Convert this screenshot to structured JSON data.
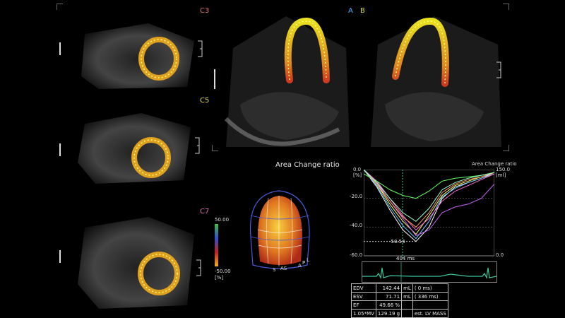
{
  "views": {
    "c3": {
      "label": "C3",
      "color": "#e07070"
    },
    "c5": {
      "label": "C5",
      "color": "#e5d65a"
    },
    "c7": {
      "label": "C7",
      "color": "#e070b0"
    },
    "a": {
      "label": "A",
      "color": "#55aaff"
    },
    "b": {
      "label": "B",
      "color": "#d6d64a"
    }
  },
  "heading": "Area Change ratio",
  "colorbar": {
    "max": "50.00",
    "min": "-50.00",
    "unit": "[%]"
  },
  "bullseye": {
    "labels": [
      "S",
      "AS",
      "A",
      "P",
      "L"
    ]
  },
  "graph": {
    "title": "Area Change ratio",
    "y_left_top": "0.0",
    "y_left_unit": "[%]",
    "y_right_top": "150.0",
    "y_right_unit": "[ml]",
    "y_right_bottom": "0.0",
    "ticks": [
      "-20.0",
      "-40.0",
      "-60.0"
    ],
    "peak_label": "-50.54",
    "time_label": "404 ms"
  },
  "chart_data": {
    "type": "line",
    "title": "Area Change ratio",
    "xlabel": "",
    "ylabel": "[%]",
    "ylim": [
      -60,
      0
    ],
    "x": [
      0,
      0.1,
      0.2,
      0.3,
      0.4,
      0.5,
      0.6,
      0.7,
      0.8,
      0.9,
      1.0
    ],
    "series": [
      {
        "color": "#ffffff",
        "values": [
          0,
          -12,
          -28,
          -42,
          -50,
          -40,
          -20,
          -12,
          -9,
          -6,
          -2
        ]
      },
      {
        "color": "#ffff66",
        "values": [
          0,
          -10,
          -24,
          -36,
          -45,
          -32,
          -18,
          -11,
          -8,
          -5,
          -2
        ]
      },
      {
        "color": "#66ccff",
        "values": [
          0,
          -11,
          -26,
          -39,
          -48,
          -36,
          -19,
          -13,
          -9,
          -6,
          -3
        ]
      },
      {
        "color": "#ff66cc",
        "values": [
          0,
          -8,
          -20,
          -32,
          -42,
          -34,
          -22,
          -15,
          -11,
          -7,
          -3
        ]
      },
      {
        "color": "#cc66ff",
        "values": [
          0,
          -9,
          -22,
          -34,
          -46,
          -42,
          -30,
          -26,
          -24,
          -20,
          -10
        ]
      },
      {
        "color": "#66ff66",
        "values": [
          -3,
          -8,
          -14,
          -18,
          -20,
          -15,
          -8,
          -6,
          -5,
          -4,
          -2
        ]
      },
      {
        "color": "#ff9966",
        "values": [
          0,
          -10,
          -22,
          -33,
          -40,
          -30,
          -16,
          -10,
          -7,
          -5,
          -2
        ]
      },
      {
        "color": "#99ffcc",
        "values": [
          0,
          -9,
          -20,
          -30,
          -36,
          -27,
          -14,
          -9,
          -6,
          -4,
          -2
        ]
      }
    ]
  },
  "measurements": [
    {
      "name": "EDV",
      "value": "142.44",
      "unit": "mL",
      "extra": "(   0  ms)"
    },
    {
      "name": "ESV",
      "value": "71.71",
      "unit": "mL",
      "extra": "( 336 ms)"
    },
    {
      "name": "EF",
      "value": "49.66 %",
      "unit": "",
      "extra": ""
    },
    {
      "name": "1.05*MV",
      "value": "129.19 g",
      "unit": "",
      "extra": "est. LV MASS"
    }
  ]
}
